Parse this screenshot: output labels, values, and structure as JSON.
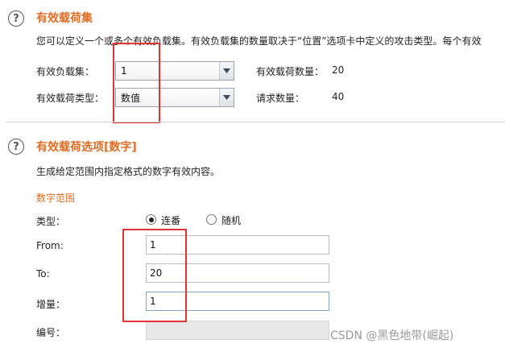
{
  "payload_sets": {
    "title": "有效载荷集",
    "description": "您可以定义一个或多个有效负载集。有效负载集的数量取决于“位置”选项卡中定义的攻击类型。每个有效",
    "payload_set_label": "有效负载集：",
    "payload_set_value": "1",
    "payload_type_label": "有效载荷类型：",
    "payload_type_value": "数值",
    "payload_count_label": "有效载荷数量：",
    "payload_count_value": "20",
    "request_count_label": "请求数量：",
    "request_count_value": "40"
  },
  "payload_options": {
    "title": "有效载荷选项[数字]",
    "description": "生成给定范围内指定格式的数字有效内容。",
    "range_title": "数字范围",
    "type_label": "类型：",
    "radio_sequential": "连番",
    "radio_random": "随机",
    "radio_selected": "sequential",
    "from_label": "From:",
    "from_value": "1",
    "to_label": "To:",
    "to_value": "20",
    "step_label": "增量：",
    "step_value": "1",
    "number_label": "编号：",
    "number_value": ""
  },
  "icons": {
    "help": "help-circle-icon",
    "dropdown": "chevron-down-icon"
  },
  "colors": {
    "accent": "#e36c25",
    "highlight": "#e53333"
  },
  "watermark": "CSDN @黑色地带(崛起)"
}
